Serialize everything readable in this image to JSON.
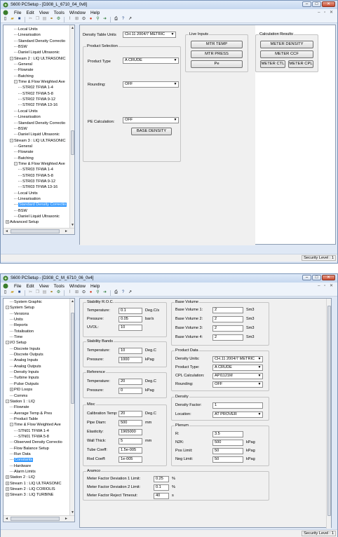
{
  "menu": [
    "File",
    "Edit",
    "View",
    "Tools",
    "Window",
    "Help"
  ],
  "status": {
    "security": "Security Level : 1"
  },
  "w1": {
    "title": "S600 PCSetup - [D308_L_6710_04_0v8]",
    "tree": [
      {
        "t": "Local Units",
        "d": 2
      },
      {
        "t": "Linearisation",
        "d": 2
      },
      {
        "t": "Standard Density Correctio",
        "d": 2
      },
      {
        "t": "BSW",
        "d": 2
      },
      {
        "t": "Daniel Liquid Ultrasonic",
        "d": 2
      },
      {
        "t": "Stream 2 : LIQ ULTRASONIC",
        "d": 1,
        "e": "-"
      },
      {
        "t": "General",
        "d": 2
      },
      {
        "t": "Flowrate",
        "d": 2
      },
      {
        "t": "Batching",
        "d": 2
      },
      {
        "t": "Time & Flow Weighted Ave",
        "d": 2,
        "e": "-"
      },
      {
        "t": "STR02 TFWA 1-4",
        "d": 3
      },
      {
        "t": "STR02 TFWA 5-8",
        "d": 3
      },
      {
        "t": "STR02 TFWA 9-12",
        "d": 3
      },
      {
        "t": "STR02 TFWA 13-16",
        "d": 3
      },
      {
        "t": "Local Units",
        "d": 2
      },
      {
        "t": "Linearisation",
        "d": 2
      },
      {
        "t": "Standard Density Correctio",
        "d": 2
      },
      {
        "t": "BSW",
        "d": 2
      },
      {
        "t": "Daniel Liquid Ultrasonic",
        "d": 2
      },
      {
        "t": "Stream 3 : LIQ ULTRASONIC",
        "d": 1,
        "e": "-"
      },
      {
        "t": "General",
        "d": 2
      },
      {
        "t": "Flowrate",
        "d": 2
      },
      {
        "t": "Batching",
        "d": 2
      },
      {
        "t": "Time & Flow Weighted Ave",
        "d": 2,
        "e": "-"
      },
      {
        "t": "STR03 TFWA 1-4",
        "d": 3
      },
      {
        "t": "STR03 TFWA 5-8",
        "d": 3
      },
      {
        "t": "STR03 TFWA 9-12",
        "d": 3
      },
      {
        "t": "STR03 TFWA 13-16",
        "d": 3
      },
      {
        "t": "Local Units",
        "d": 2
      },
      {
        "t": "Linearisation",
        "d": 2
      },
      {
        "t": "Standard Density Correctio",
        "d": 2,
        "sel": true
      },
      {
        "t": "BSW",
        "d": 2
      },
      {
        "t": "Daniel Liquid Ultrasonic",
        "d": 2
      },
      {
        "t": "Advanced Setup",
        "d": 0,
        "e": "+"
      }
    ],
    "density_table_label": "Density Table Units",
    "density_table_value": "CH.11 2004/7 METRIC",
    "product_selection": {
      "title": "Product Selection",
      "product_type_label": "Product Type",
      "product_type": "A CRUDE",
      "rounding_label": "Rounding:",
      "rounding": "OFF",
      "pe_label": "PE Calculation:",
      "pe": "OFF",
      "base_density_btn": "BASE DENSITY"
    },
    "live_inputs": {
      "title": "Live Inputs",
      "btn1": "MTR TEMP",
      "btn2": "MTR PRESS",
      "btn3": "Pe"
    },
    "calc_results": {
      "title": "Calculation Results",
      "btn1": "METER DENSITY",
      "btn2": "METER CCF",
      "btn3": "METER CTL",
      "btn4": "METER CPL"
    }
  },
  "w2": {
    "title": "S600 PCSetup - [D308_C_M_6710_06_0v4]",
    "tree": [
      {
        "t": "System Graphic",
        "d": 1
      },
      {
        "t": "System Setup",
        "d": 0,
        "e": "-"
      },
      {
        "t": "Versions",
        "d": 1
      },
      {
        "t": "Units",
        "d": 1
      },
      {
        "t": "Reports",
        "d": 1
      },
      {
        "t": "Totalisation",
        "d": 1
      },
      {
        "t": "Time",
        "d": 1
      },
      {
        "t": "I/O Setup",
        "d": 0,
        "e": "-"
      },
      {
        "t": "Discrete Inputs",
        "d": 1
      },
      {
        "t": "Discrete Outputs",
        "d": 1
      },
      {
        "t": "Analog Inputs",
        "d": 1
      },
      {
        "t": "Analog Outputs",
        "d": 1
      },
      {
        "t": "Density Inputs",
        "d": 1
      },
      {
        "t": "Turbine Inputs",
        "d": 1
      },
      {
        "t": "Pulse Outputs",
        "d": 1
      },
      {
        "t": "PID Loops",
        "d": 1,
        "e": "+"
      },
      {
        "t": "Comms",
        "d": 1
      },
      {
        "t": "Station 1 : LIQ",
        "d": 0,
        "e": "-"
      },
      {
        "t": "Flowrate",
        "d": 1
      },
      {
        "t": "Average Temp & Pres",
        "d": 1
      },
      {
        "t": "Product Table",
        "d": 1
      },
      {
        "t": "Time & Flow Weighted Ave",
        "d": 1,
        "e": "-"
      },
      {
        "t": "STN01 TFWA 1-4",
        "d": 2
      },
      {
        "t": "STN01 TFWA 5-8",
        "d": 2
      },
      {
        "t": "Observed Density Correctio",
        "d": 1
      },
      {
        "t": "Flow Balance Setup",
        "d": 1
      },
      {
        "t": "Run Data",
        "d": 1
      },
      {
        "t": "Constants",
        "d": 1,
        "sel": true
      },
      {
        "t": "Hardware",
        "d": 1
      },
      {
        "t": "Alarm Limits",
        "d": 1
      },
      {
        "t": "Station 2 : LIQ",
        "d": 0,
        "e": "+"
      },
      {
        "t": "Stream 1 : LIQ ULTRASONIC",
        "d": 0,
        "e": "+"
      },
      {
        "t": "Stream 2 : LIQ CORIOLIS",
        "d": 0,
        "e": "+"
      },
      {
        "t": "Stream 3 : LIQ TURBINE",
        "d": 0,
        "e": "+"
      }
    ],
    "stability_roc": {
      "title": "Stability R.O.C.",
      "rows": [
        {
          "l": "Temperature:",
          "v": "0.1",
          "u": "Deg.C/s"
        },
        {
          "l": "Pressure:",
          "v": "0.05",
          "u": "bar/s"
        },
        {
          "l": "UVOL:",
          "v": "10",
          "u": ""
        }
      ]
    },
    "stability_bands": {
      "title": "Stability Bands",
      "rows": [
        {
          "l": "Temperature:",
          "v": "10",
          "u": "Deg.C"
        },
        {
          "l": "Pressure:",
          "v": "1000",
          "u": "kPag"
        }
      ]
    },
    "reference": {
      "title": "Reference",
      "rows": [
        {
          "l": "Temperature:",
          "v": "20",
          "u": "Deg.C"
        },
        {
          "l": "Pressure:",
          "v": "0",
          "u": "kPag"
        }
      ]
    },
    "misc": {
      "title": "Misc",
      "rows": [
        {
          "l": "Calibration Temp:",
          "v": "20",
          "u": "Deg.C"
        },
        {
          "l": "Pipe Diam:",
          "v": "500",
          "u": "mm"
        },
        {
          "l": "Elasticity:",
          "v": "1965000",
          "u": ""
        },
        {
          "l": "Wall Thick:",
          "v": "5",
          "u": "mm"
        },
        {
          "l": "Tube Coeff:",
          "v": "1.5e-005",
          "u": ""
        },
        {
          "l": "Rod Coeff:",
          "v": "1e-005",
          "u": ""
        }
      ]
    },
    "base_volume": {
      "title": "Base Volume",
      "rows": [
        {
          "l": "Base Volume 1:",
          "v": "2",
          "u": "Sm3"
        },
        {
          "l": "Base Volume 2:",
          "v": "2",
          "u": "Sm3"
        },
        {
          "l": "Base Volume 3:",
          "v": "2",
          "u": "Sm3"
        },
        {
          "l": "Base Volume 4:",
          "v": "2",
          "u": "Sm3"
        }
      ]
    },
    "product_data": {
      "title": "Product Data",
      "rows": [
        {
          "l": "Density Units:",
          "v": "CH.11 2004/7 METRIC"
        },
        {
          "l": "Product Type:",
          "v": "A CRUDE"
        },
        {
          "l": "CPL Calculation:",
          "v": "API1121M"
        },
        {
          "l": "Rounding:",
          "v": "OFF"
        }
      ]
    },
    "density": {
      "title": "Density",
      "rows": [
        {
          "l": "Density Factor:",
          "v": "1"
        },
        {
          "l": "Location:",
          "v": "AT PROVER"
        }
      ]
    },
    "plenum": {
      "title": "Plenum",
      "rows": [
        {
          "l": "R:",
          "v": "3.5",
          "u": ""
        },
        {
          "l": "N2K:",
          "v": "500",
          "u": "kPag"
        },
        {
          "l": "Pos Limit:",
          "v": "50",
          "u": "kPag"
        },
        {
          "l": "Neg Limit:",
          "v": "50",
          "u": "kPag"
        }
      ]
    },
    "aramco": {
      "title": "Aramco",
      "rows": [
        {
          "l": "Meter Factor Deviation 1 Limit:",
          "v": "0.25",
          "u": "%"
        },
        {
          "l": "Meter Factor Deviation 2 Limit:",
          "v": "0.1",
          "u": "%"
        },
        {
          "l": "Meter Factor Reject Timeout:",
          "v": "40",
          "u": "s"
        }
      ]
    }
  }
}
